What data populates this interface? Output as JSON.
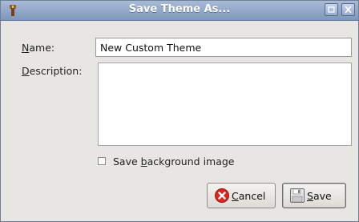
{
  "window": {
    "title": "Save Theme As..."
  },
  "form": {
    "name_label_mnemonic": "N",
    "name_label_rest": "ame:",
    "name_value": "New Custom Theme",
    "description_label_mnemonic": "D",
    "description_label_rest": "escription:",
    "description_value": "",
    "save_background_pre": "Save ",
    "save_background_mnemonic": "b",
    "save_background_post": "ackground image",
    "save_background_checked": false
  },
  "buttons": {
    "cancel_mnemonic": "C",
    "cancel_rest": "ancel",
    "save_mnemonic": "S",
    "save_rest": "ave"
  },
  "icons": {
    "app": "app-icon",
    "maximize": "maximize-icon",
    "close": "close-icon",
    "cancel": "cancel-icon",
    "save": "floppy-disk-icon"
  },
  "colors": {
    "titlebar": "#8aa1c4",
    "cancel_red": "#d9251d"
  }
}
